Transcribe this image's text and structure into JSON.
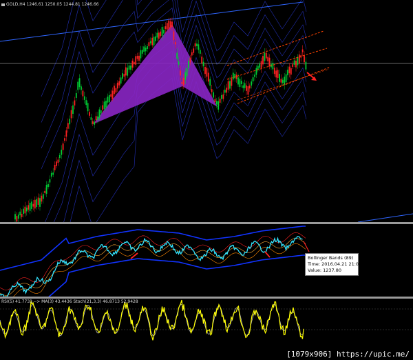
{
  "main_chart": {
    "symbol_label": "GOLD,H4",
    "ohlc_values": "1246.61 1250.05 1244.81 1246.66"
  },
  "bollinger_tooltip": {
    "title": "Bollinger Bands (89)",
    "time": "Time: 2016.04.21 21:00",
    "value": "Value: 1237.80"
  },
  "oscillator": {
    "header": "RSI(5) 41.7733 --> MA(3) 43.4436 Stoch(21,3,3) 46.8713 52.9428"
  },
  "watermark": {
    "text": "[1079x906] https://upic.me/"
  },
  "colors": {
    "background": "#000000",
    "candle_bull": "#00cc33",
    "candle_bear": "#ff2222",
    "harmonic_pattern": "#8a26c4",
    "channel_lines": "#ff4400",
    "band_lines": "#2c3ce6",
    "bollinger": "#1133ff",
    "price_line": "#33e5ff",
    "rsi_line": "#ffff00",
    "stoch_line": "#bbbbbb",
    "trendline": "#2f66ff"
  },
  "icons": [
    "chart-type-icon",
    "arrow-annotation-icon"
  ]
}
